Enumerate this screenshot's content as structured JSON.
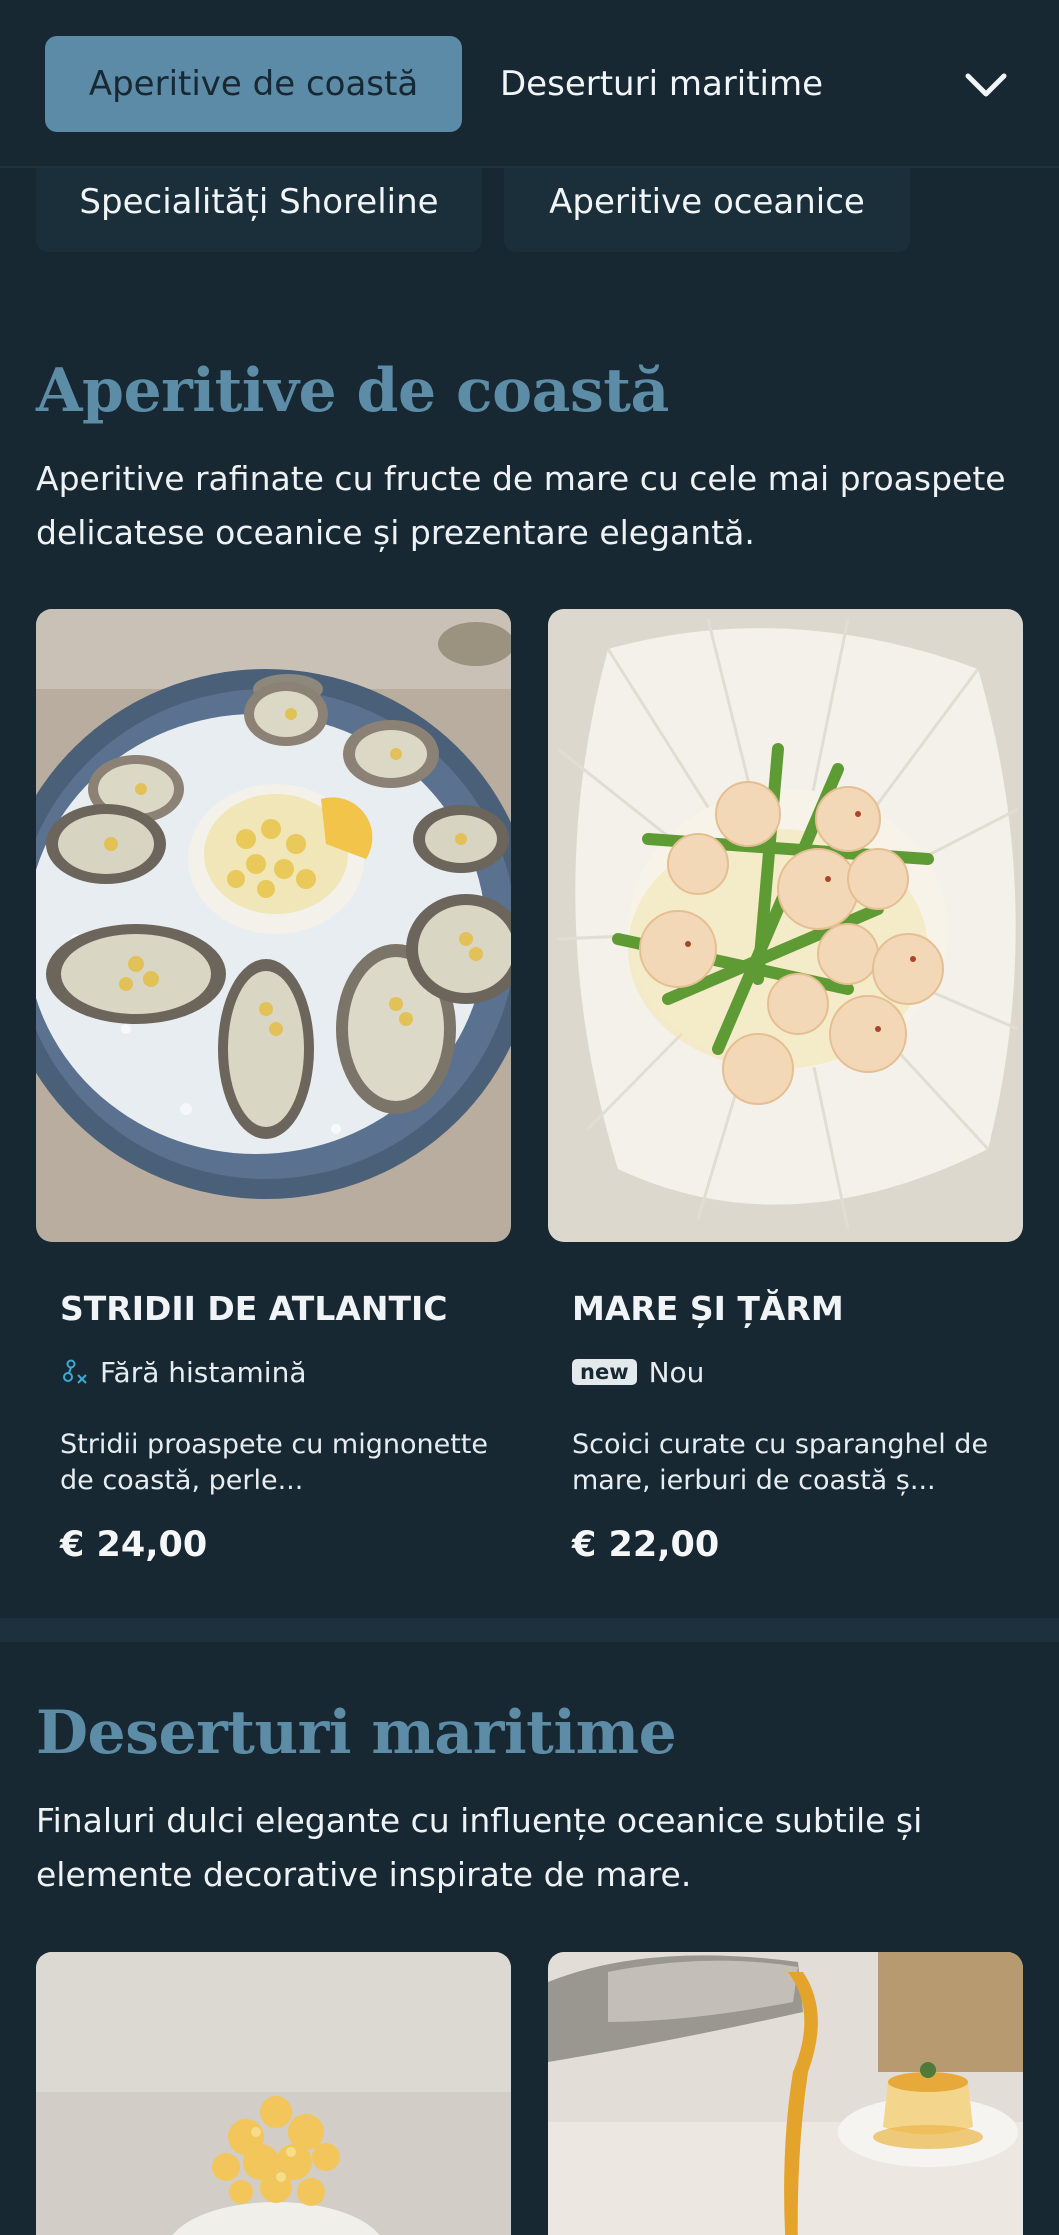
{
  "nav": {
    "active_tab": "Aperitive de coastă",
    "tab_2": "Deserturi maritime",
    "row2_tab_1": "Specialități Shoreline",
    "row2_tab_2": "Aperitive oceanice",
    "expand_icon": "chevron-down-icon"
  },
  "sections": [
    {
      "title": "Aperitive de coastă",
      "description": "Aperitive rafinate cu fructe de mare cu cele mai proaspete delicatese oceanice și prezentare elegantă.",
      "items": [
        {
          "name": "STRIDII DE ATLANTIC",
          "tag_icon": "histamine-free-icon",
          "tag": "Fără histamină",
          "description": "Stridii proaspete cu mignonette de coastă, perle...",
          "price": "€ 24,00"
        },
        {
          "name": "MARE ȘI ȚĂRM",
          "tag_badge": "new",
          "tag": "Nou",
          "description": "Scoici curate cu sparanghel de mare, ierburi de coastă ș...",
          "price": "€ 22,00"
        }
      ]
    },
    {
      "title": "Deserturi maritime",
      "description": "Finaluri dulci elegante cu influențe oceanice subtile și elemente decorative inspirate de mare."
    }
  ],
  "colors": {
    "background": "#172833",
    "accent": "#5b8ba6",
    "section_title": "#5d8ca7",
    "text": "#eef2f4"
  }
}
